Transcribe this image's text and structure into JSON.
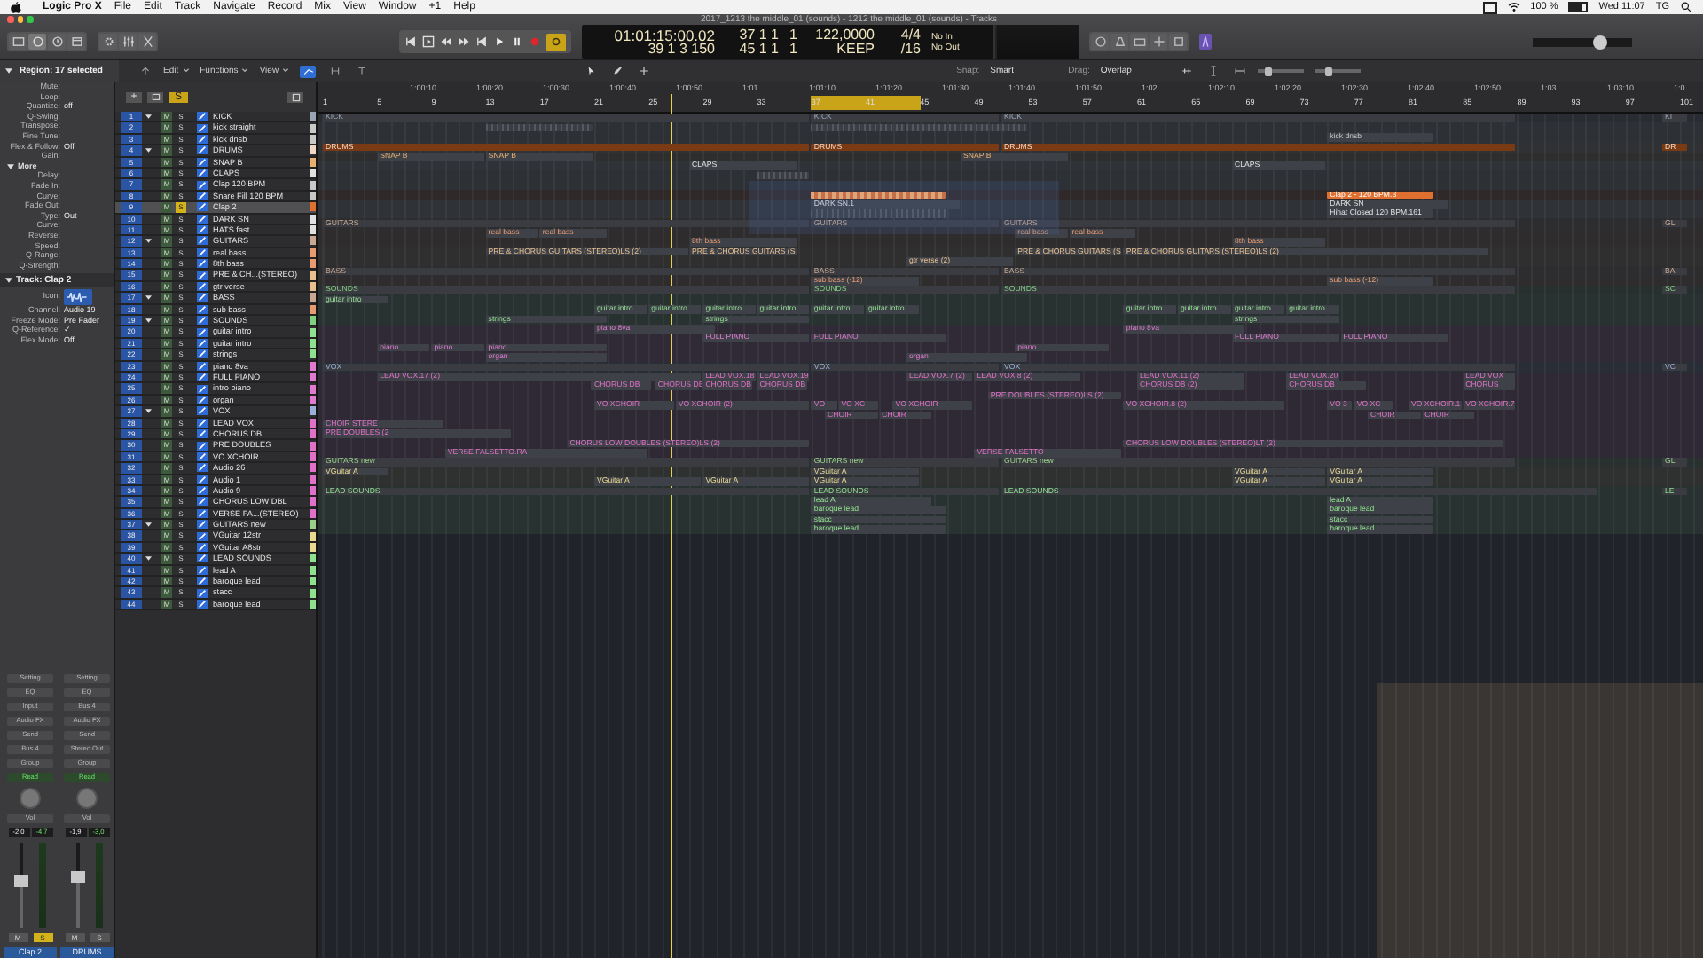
{
  "menubar": {
    "app": "Logic Pro X",
    "menus": [
      "File",
      "Edit",
      "Track",
      "Navigate",
      "Record",
      "Mix",
      "View",
      "Window",
      "+1",
      "Help"
    ],
    "battery": "100 %",
    "clock": "Wed 11:07",
    "user": "TG"
  },
  "window": {
    "title": "2017_1213 the middle_01 (sounds) - 1212 the middle_01 (sounds) - Tracks"
  },
  "lcd": {
    "time": "01:01:15:00.02",
    "position": "39 1 3 150",
    "locator_left": "37 1 1",
    "locator_right": "45 1 1",
    "tempo_bar": "1",
    "tempo": "122,0000",
    "tempo_mode_bar": "1",
    "tempo_mode": "KEEP",
    "signature": "4/4",
    "division": "/16",
    "midi_in": "No In",
    "midi_out": "No Out"
  },
  "transport": {
    "cycle": {
      "on": true
    },
    "playhead": {
      "level": 0.256
    }
  },
  "master_volume": {
    "level": 0.67
  },
  "inspector": {
    "title": "Region: 17 selected",
    "params": [
      {
        "label": "Mute:",
        "kind": "param"
      },
      {
        "label": "Loop:",
        "kind": "param"
      },
      {
        "label": "Quantize:",
        "value": "off",
        "kind": "param"
      },
      {
        "label": "Q-Swing:",
        "kind": "param"
      },
      {
        "label": "Transpose:",
        "kind": "param"
      },
      {
        "label": "Fine Tune:",
        "kind": "param"
      },
      {
        "label": "Flex & Follow:",
        "value": "Off",
        "kind": "param"
      },
      {
        "label": "Gain:",
        "kind": "param"
      },
      {
        "label": "More",
        "kind": "section"
      },
      {
        "label": "Delay:",
        "kind": "param"
      },
      {
        "label": "Fade In:",
        "kind": "param"
      },
      {
        "label": "Curve:",
        "kind": "param"
      },
      {
        "label": "Fade Out:",
        "kind": "param"
      },
      {
        "label": "Type:",
        "value": "Out",
        "kind": "param"
      },
      {
        "label": "Curve:",
        "kind": "param"
      },
      {
        "label": "Reverse:",
        "kind": "param"
      },
      {
        "label": "Speed:",
        "kind": "param"
      },
      {
        "label": "Q-Range:",
        "kind": "param"
      },
      {
        "label": "Q-Strength:",
        "kind": "param"
      }
    ],
    "track_title": "Track:  Clap 2",
    "track_params": [
      {
        "label": "Icon:",
        "kind": "icon"
      },
      {
        "label": "Channel:",
        "value": "Audio 19",
        "kind": "param"
      },
      {
        "label": "Freeze Mode:",
        "value": "Pre Fader",
        "kind": "param"
      },
      {
        "label": "Q-Reference:",
        "value": "✓",
        "kind": "param"
      },
      {
        "label": "Flex Mode:",
        "value": "Off",
        "kind": "param"
      }
    ]
  },
  "channel_strips": [
    {
      "name": "Clap 2",
      "slots": [
        "Setting",
        "EQ",
        "Input",
        "Audio FX",
        "Send",
        "Bus 4",
        "Group"
      ],
      "automation": "Read",
      "pan": "Vol",
      "readout": "-2,0",
      "peak": "-4,7",
      "level": 0.62,
      "mute": "M",
      "solo_label": "S",
      "solo": true
    },
    {
      "name": "DRUMS",
      "slots": [
        "Setting",
        "EQ",
        "Bus 4",
        "Audio FX",
        "Send",
        "Stereo Out",
        "Group"
      ],
      "automation": "Read",
      "pan": "Vol",
      "readout": "-1,9",
      "peak": "-3,0",
      "level": 0.66,
      "mute": "M",
      "solo_label": "S",
      "solo": false
    }
  ],
  "edit_bar": {
    "menus": [
      "Edit",
      "Functions",
      "View"
    ],
    "snap_label": "Snap:",
    "snap": "Smart",
    "drag_label": "Drag:",
    "drag": "Overlap",
    "zoom_sliders": [
      {
        "level": 0.2
      },
      {
        "level": 0.3
      }
    ]
  },
  "ruler": {
    "bars": [
      "1",
      "5",
      "9",
      "13",
      "17",
      "21",
      "25",
      "29",
      "33",
      "37",
      "41",
      "45",
      "49",
      "53",
      "57",
      "61",
      "65",
      "69",
      "73",
      "77",
      "81",
      "85",
      "89",
      "93",
      "97",
      "101"
    ],
    "times": [
      "1:00:10",
      "1:00:20",
      "1:00:30",
      "1:00:40",
      "1:00:50",
      "1:01",
      "1:01:10",
      "1:01:20",
      "1:01:30",
      "1:01:40",
      "1:01:50",
      "1:02",
      "1:02:10",
      "1:02:20",
      "1:02:30",
      "1:02:40",
      "1:02:50",
      "1:03",
      "1:03:10",
      "1:0"
    ]
  },
  "track_header": {
    "add_button": "+",
    "solo_button": "S"
  },
  "tracks": [
    {
      "num": "1",
      "name": "KICK",
      "folder": true,
      "selected": false,
      "mute_label": "M",
      "solo_label": "S",
      "solo": false,
      "color": "#9aa4b4",
      "regions": [
        {
          "label": "KICK"
        },
        {
          "label": "KICK"
        },
        {
          "label": "KICK"
        },
        {
          "label": "KI"
        }
      ]
    },
    {
      "num": "2",
      "name": "kick straight",
      "folder": false,
      "selected": false,
      "mute_label": "M",
      "solo_label": "S",
      "solo": false,
      "color": "#c8c8c8",
      "regions": [
        {
          "waveform": true
        },
        {
          "waveform": true
        },
        {
          "waveform": true
        }
      ]
    },
    {
      "num": "3",
      "name": "kick dnsb",
      "folder": false,
      "selected": false,
      "mute_label": "M",
      "solo_label": "S",
      "solo": false,
      "color": "#c8c8c8",
      "regions": [
        {
          "label": "kick dnsb"
        }
      ]
    },
    {
      "num": "4",
      "name": "DRUMS",
      "folder": true,
      "selected": false,
      "mute_label": "M",
      "solo_label": "S",
      "solo": false,
      "color": "#f0d8c8",
      "regions": [
        {
          "label": "DRUMS"
        },
        {
          "label": "DRUMS"
        },
        {
          "label": "DRUMS"
        },
        {
          "label": "DR"
        }
      ]
    },
    {
      "num": "5",
      "name": "SNAP B",
      "folder": false,
      "selected": false,
      "mute_label": "M",
      "solo_label": "S",
      "solo": false,
      "color": "#e8b070",
      "regions": [
        {
          "label": "SNAP B"
        },
        {
          "label": "SNAP B"
        },
        {
          "label": "SNAP B"
        }
      ]
    },
    {
      "num": "6",
      "name": "CLAPS",
      "folder": false,
      "selected": false,
      "mute_label": "M",
      "solo_label": "S",
      "solo": false,
      "color": "#e0e0e0",
      "regions": [
        {
          "label": "CLAPS"
        },
        {
          "label": "CLAPS"
        }
      ]
    },
    {
      "num": "7",
      "name": "Clap 120 BPM",
      "folder": false,
      "selected": false,
      "mute_label": "M",
      "solo_label": "S",
      "solo": false,
      "color": "#c8c8c8",
      "regions": [
        {
          "waveform": true
        }
      ]
    },
    {
      "num": "8",
      "name": "Snare Fill 120 BPM",
      "folder": false,
      "selected": false,
      "mute_label": "M",
      "solo_label": "S",
      "solo": false,
      "color": "#c8c8c8"
    },
    {
      "num": "9",
      "name": "Clap 2",
      "folder": false,
      "selected": true,
      "mute_label": "M",
      "solo_label": "S",
      "solo": true,
      "color": "#e07030",
      "regions": [
        {
          "waveform": true,
          "selected": true
        },
        {
          "label": "Clap 2 - 120 BPM.3",
          "selected": true
        }
      ]
    },
    {
      "num": "10",
      "name": "DARK SN",
      "folder": false,
      "selected": false,
      "mute_label": "M",
      "solo_label": "S",
      "solo": false,
      "color": "#e0e0e0",
      "regions": [
        {
          "label": "DARK SN.1"
        },
        {
          "label": "DARK SN"
        }
      ]
    },
    {
      "num": "11",
      "name": "HATS fast",
      "folder": false,
      "selected": false,
      "mute_label": "M",
      "solo_label": "S",
      "solo": false,
      "color": "#e0e0e0",
      "regions": [
        {
          "waveform": true
        },
        {
          "label": "Hihat Closed 120 BPM.161"
        }
      ]
    },
    {
      "num": "12",
      "name": "GUITARS",
      "folder": true,
      "selected": false,
      "mute_label": "M",
      "solo_label": "S",
      "solo": false,
      "color": "#c8a890",
      "regions": [
        {
          "label": "GUITARS"
        },
        {
          "label": "GUITARS"
        },
        {
          "label": "GUITARS"
        },
        {
          "label": "GL"
        }
      ]
    },
    {
      "num": "13",
      "name": "real bass",
      "folder": false,
      "selected": false,
      "mute_label": "M",
      "solo_label": "S",
      "solo": false,
      "color": "#e89a70",
      "regions": [
        {
          "label": "real bass"
        },
        {
          "label": "real bass"
        },
        {
          "label": "real bass"
        },
        {
          "label": "real bass"
        }
      ]
    },
    {
      "num": "14",
      "name": "8th bass",
      "folder": false,
      "selected": false,
      "mute_label": "M",
      "solo_label": "S",
      "solo": false,
      "color": "#e89a70",
      "regions": [
        {
          "label": "8th bass"
        },
        {
          "label": "8th bass"
        }
      ]
    },
    {
      "num": "15",
      "name": "PRE & CH...(STEREO)",
      "folder": false,
      "selected": false,
      "mute_label": "M",
      "solo_label": "S",
      "solo": false,
      "color": "#e8c090",
      "regions": [
        {
          "label": "PRE & CHORUS GUITARS (STEREO)LS  (2)"
        },
        {
          "label": "PRE & CHORUS GUITARS (S"
        },
        {
          "label": "PRE & CHORUS GUITARS (S"
        },
        {
          "label": "PRE & CHORUS GUITARS (STEREO)LS  (2)"
        }
      ]
    },
    {
      "num": "16",
      "name": "gtr verse",
      "folder": false,
      "selected": false,
      "mute_label": "M",
      "solo_label": "S",
      "solo": false,
      "color": "#e8c090",
      "regions": [
        {
          "label": "gtr verse  (2)"
        }
      ]
    },
    {
      "num": "17",
      "name": "BASS",
      "folder": true,
      "selected": false,
      "mute_label": "M",
      "solo_label": "S",
      "solo": false,
      "color": "#c8a890",
      "regions": [
        {
          "label": "BASS"
        },
        {
          "label": "BASS"
        },
        {
          "label": "BASS"
        },
        {
          "label": "BA"
        }
      ]
    },
    {
      "num": "18",
      "name": "sub bass",
      "folder": false,
      "selected": false,
      "mute_label": "M",
      "solo_label": "S",
      "solo": false,
      "color": "#e89a70",
      "regions": [
        {
          "label": "sub bass (-12)"
        },
        {
          "label": "sub bass (-12)"
        }
      ]
    },
    {
      "num": "19",
      "name": "SOUNDS",
      "folder": true,
      "selected": false,
      "mute_label": "M",
      "solo_label": "S",
      "solo": false,
      "color": "#7fd07f",
      "regions": [
        {
          "label": "SOUNDS"
        },
        {
          "label": "SOUNDS"
        },
        {
          "label": "SOUNDS"
        },
        {
          "label": "SC"
        }
      ]
    },
    {
      "num": "20",
      "name": "guitar intro",
      "folder": false,
      "selected": false,
      "mute_label": "M",
      "solo_label": "S",
      "solo": false,
      "color": "#8fe08f",
      "regions": [
        {
          "label": "guitar intro"
        }
      ]
    },
    {
      "num": "21",
      "name": "guitar intro",
      "folder": false,
      "selected": false,
      "mute_label": "M",
      "solo_label": "S",
      "solo": false,
      "color": "#8fe08f",
      "regions": [
        {
          "label": "guitar intro"
        },
        {
          "label": "guitar intro"
        },
        {
          "label": "guitar intro"
        },
        {
          "label": "guitar intro"
        },
        {
          "label": "guitar intro"
        },
        {
          "label": "guitar intro"
        },
        {
          "label": "guitar intro"
        },
        {
          "label": "guitar intro"
        },
        {
          "label": "guitar intro"
        },
        {
          "label": "guitar intro"
        }
      ]
    },
    {
      "num": "22",
      "name": "strings",
      "folder": false,
      "selected": false,
      "mute_label": "M",
      "solo_label": "S",
      "solo": false,
      "color": "#8fe08f",
      "regions": [
        {
          "label": "strings"
        },
        {
          "label": "strings"
        },
        {
          "label": "strings"
        }
      ]
    },
    {
      "num": "23",
      "name": "piano 8va",
      "folder": false,
      "selected": false,
      "mute_label": "M",
      "solo_label": "S",
      "solo": false,
      "color": "#e07ad0",
      "regions": [
        {
          "label": "piano 8va"
        },
        {
          "label": "piano 8va"
        }
      ]
    },
    {
      "num": "24",
      "name": "FULL PIANO",
      "folder": false,
      "selected": false,
      "mute_label": "M",
      "solo_label": "S",
      "solo": false,
      "color": "#e07ad0",
      "regions": [
        {
          "label": "FULL PIANO"
        },
        {
          "label": "FULL PIANO"
        },
        {
          "label": "FULL PIANO"
        },
        {
          "label": "FULL PIANO"
        }
      ]
    },
    {
      "num": "25",
      "name": "intro piano",
      "folder": false,
      "selected": false,
      "mute_label": "M",
      "solo_label": "S",
      "solo": false,
      "color": "#e07ad0",
      "regions": [
        {
          "label": "piano"
        },
        {
          "label": "piano"
        },
        {
          "label": "piano"
        },
        {
          "label": "piano"
        }
      ]
    },
    {
      "num": "26",
      "name": "organ",
      "folder": false,
      "selected": false,
      "mute_label": "M",
      "solo_label": "S",
      "solo": false,
      "color": "#e07ad0",
      "regions": [
        {
          "label": "organ"
        },
        {
          "label": "organ"
        }
      ]
    },
    {
      "num": "27",
      "name": "VOX",
      "folder": true,
      "selected": false,
      "mute_label": "M",
      "solo_label": "S",
      "solo": false,
      "color": "#9ab0d8",
      "regions": [
        {
          "label": "VOX"
        },
        {
          "label": "VOX"
        },
        {
          "label": "VOX"
        },
        {
          "label": "VC"
        }
      ]
    },
    {
      "num": "28",
      "name": "LEAD VOX",
      "folder": false,
      "selected": false,
      "mute_label": "M",
      "solo_label": "S",
      "solo": false,
      "color": "#e070c8",
      "regions": [
        {
          "label": "LEAD VOX.17  (2)"
        },
        {
          "label": "LEAD VOX.18"
        },
        {
          "label": "LEAD VOX.19"
        },
        {
          "label": "LEAD VOX.7  (2)"
        },
        {
          "label": "LEAD VOX.8  (2)"
        },
        {
          "label": "LEAD VOX.11  (2)"
        },
        {
          "label": "LEAD VOX.20"
        },
        {
          "label": "LEAD VOX"
        }
      ]
    },
    {
      "num": "29",
      "name": "CHORUS DB",
      "folder": false,
      "selected": false,
      "mute_label": "M",
      "solo_label": "S",
      "solo": false,
      "color": "#e070c8",
      "regions": [
        {
          "label": "CHORUS DB"
        },
        {
          "label": "CHORUS DB"
        },
        {
          "label": "CHORUS DB"
        },
        {
          "label": "CHORUS DB"
        },
        {
          "label": "CHORUS DB  (2)"
        },
        {
          "label": "CHORUS DB"
        },
        {
          "label": "CHORUS"
        }
      ]
    },
    {
      "num": "30",
      "name": "PRE DOUBLES",
      "folder": false,
      "selected": false,
      "mute_label": "M",
      "solo_label": "S",
      "solo": false,
      "color": "#e070c8",
      "regions": [
        {
          "label": "PRE DOUBLES (STEREO)LS  (2)"
        }
      ]
    },
    {
      "num": "31",
      "name": "VO XCHOIR",
      "folder": false,
      "selected": false,
      "mute_label": "M",
      "solo_label": "S",
      "solo": false,
      "color": "#e070c8",
      "regions": [
        {
          "label": "VO XCHOIR"
        },
        {
          "label": "VO XCHOIR  (2)"
        },
        {
          "label": "VO"
        },
        {
          "label": "VO XC"
        },
        {
          "label": "VO XCHOIR"
        },
        {
          "label": "VO XCHOIR.8  (2)"
        },
        {
          "label": "VO 3"
        },
        {
          "label": "VO XC"
        },
        {
          "label": "VO XCHOIR.1"
        },
        {
          "label": "VO XCHOIR.7"
        }
      ]
    },
    {
      "num": "32",
      "name": "Audio 26",
      "folder": false,
      "selected": false,
      "mute_label": "M",
      "solo_label": "S",
      "solo": false,
      "color": "#e070c8",
      "regions": [
        {
          "label": "CHOIR"
        },
        {
          "label": "CHOIR"
        },
        {
          "label": "CHOIR"
        },
        {
          "label": "CHOIR"
        }
      ]
    },
    {
      "num": "33",
      "name": "Audio 1",
      "folder": false,
      "selected": false,
      "mute_label": "M",
      "solo_label": "S",
      "solo": false,
      "color": "#e070c8",
      "regions": [
        {
          "label": "CHOIR STERE"
        }
      ]
    },
    {
      "num": "34",
      "name": "Audio 9",
      "folder": false,
      "selected": false,
      "mute_label": "M",
      "solo_label": "S",
      "solo": false,
      "color": "#e070c8",
      "regions": [
        {
          "label": "PRE DOUBLES (2"
        }
      ]
    },
    {
      "num": "35",
      "name": "CHORUS LOW DBL",
      "folder": false,
      "selected": false,
      "mute_label": "M",
      "solo_label": "S",
      "solo": false,
      "color": "#e070c8",
      "regions": [
        {
          "label": "CHORUS LOW DOUBLES (STEREO)LS  (2)"
        },
        {
          "label": "CHORUS LOW DOUBLES (STEREO)LT  (2)"
        }
      ]
    },
    {
      "num": "36",
      "name": "VERSE FA...(STEREO)",
      "folder": false,
      "selected": false,
      "mute_label": "M",
      "solo_label": "S",
      "solo": false,
      "color": "#e070c8",
      "regions": [
        {
          "label": "VERSE FALSETTO.RA"
        },
        {
          "label": "VERSE FALSETTO"
        }
      ]
    },
    {
      "num": "37",
      "name": "GUITARS new",
      "folder": true,
      "selected": false,
      "mute_label": "M",
      "solo_label": "S",
      "solo": false,
      "color": "#9ad08a",
      "regions": [
        {
          "label": "GUITARS new"
        },
        {
          "label": "GUITARS new"
        },
        {
          "label": "GUITARS new"
        },
        {
          "label": "GL"
        }
      ]
    },
    {
      "num": "38",
      "name": "VGuitar 12str",
      "folder": false,
      "selected": false,
      "mute_label": "M",
      "solo_label": "S",
      "solo": false,
      "color": "#e8d890",
      "regions": [
        {
          "label": "VGuitar A"
        },
        {
          "label": "VGuitar A"
        },
        {
          "label": "VGuitar A"
        },
        {
          "label": "VGuitar A"
        }
      ]
    },
    {
      "num": "39",
      "name": "VGuitar A8str",
      "folder": false,
      "selected": false,
      "mute_label": "M",
      "solo_label": "S",
      "solo": false,
      "color": "#e8d890",
      "regions": [
        {
          "label": "VGuitar A"
        },
        {
          "label": "VGuitar A"
        },
        {
          "label": "VGuitar A"
        },
        {
          "label": "VGuitar A"
        },
        {
          "label": "VGuitar A"
        }
      ]
    },
    {
      "num": "40",
      "name": "LEAD SOUNDS",
      "folder": true,
      "selected": false,
      "mute_label": "M",
      "solo_label": "S",
      "solo": false,
      "color": "#8fe08f",
      "regions": [
        {
          "label": "LEAD SOUNDS"
        },
        {
          "label": "LEAD SOUNDS"
        },
        {
          "label": "LEAD SOUNDS"
        },
        {
          "label": "LE"
        }
      ]
    },
    {
      "num": "41",
      "name": "lead A",
      "folder": false,
      "selected": false,
      "mute_label": "M",
      "solo_label": "S",
      "solo": false,
      "color": "#8fe08f",
      "regions": [
        {
          "label": "lead A"
        },
        {
          "label": "lead A"
        }
      ]
    },
    {
      "num": "42",
      "name": "baroque lead",
      "folder": false,
      "selected": false,
      "mute_label": "M",
      "solo_label": "S",
      "solo": false,
      "color": "#8fe08f",
      "regions": [
        {
          "label": "baroque lead"
        },
        {
          "label": "baroque lead"
        }
      ]
    },
    {
      "num": "43",
      "name": "stacc",
      "folder": false,
      "selected": false,
      "mute_label": "M",
      "solo_label": "S",
      "solo": false,
      "color": "#8fe08f",
      "regions": [
        {
          "label": "stacc"
        },
        {
          "label": "stacc"
        }
      ]
    },
    {
      "num": "44",
      "name": "baroque lead",
      "folder": false,
      "selected": false,
      "mute_label": "M",
      "solo_label": "S",
      "solo": false,
      "color": "#8fe08f",
      "regions": [
        {
          "label": "baroque lead"
        },
        {
          "label": "baroque lead"
        }
      ]
    }
  ]
}
